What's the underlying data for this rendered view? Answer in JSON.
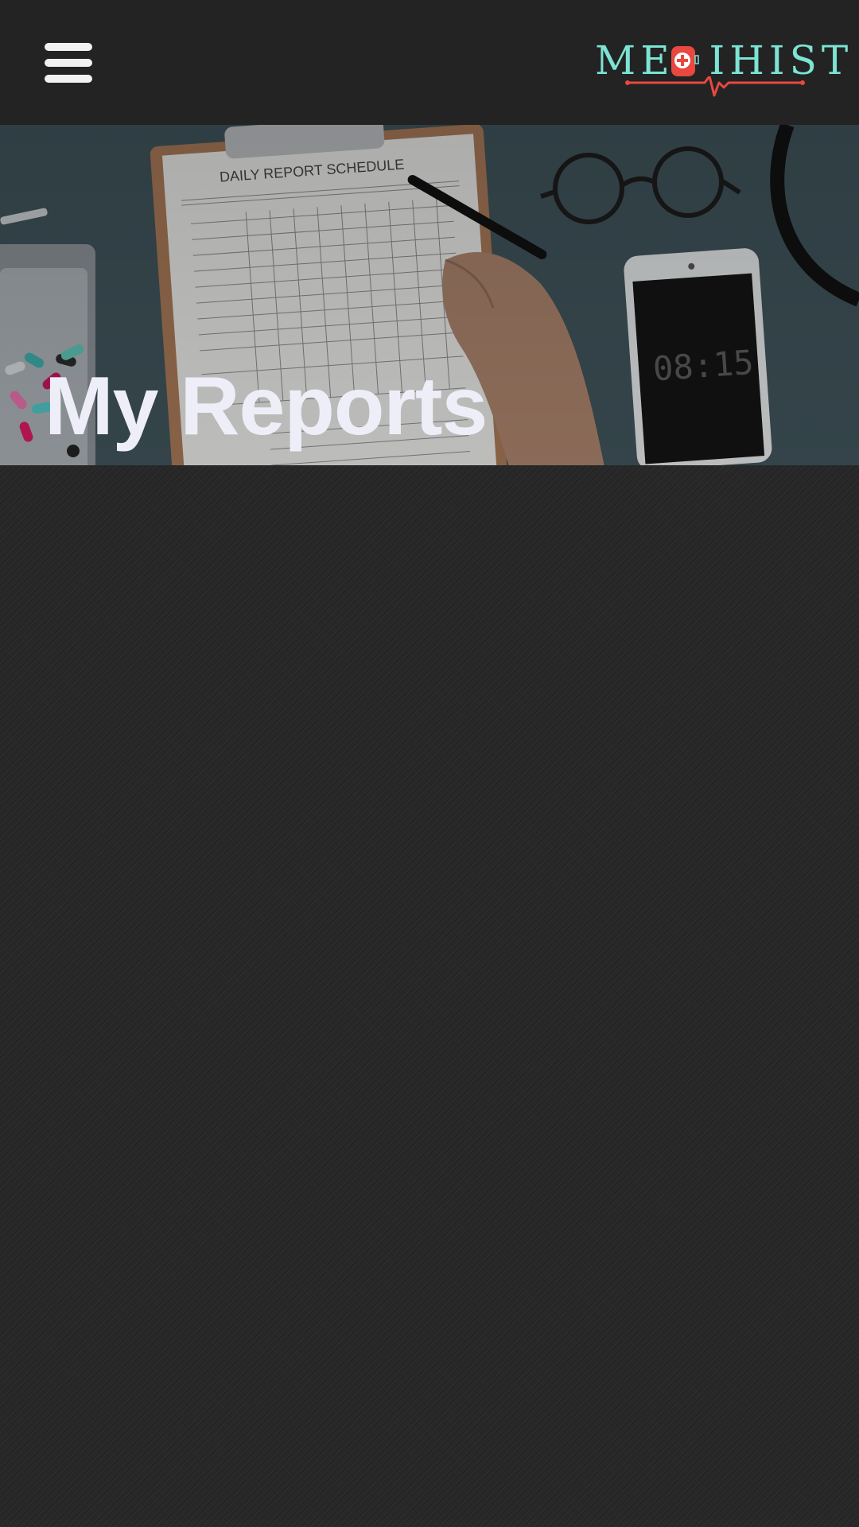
{
  "header": {
    "menu_icon": "hamburger-menu-icon",
    "logo_text": "ME  IHIST",
    "logo_alt": "MEDIHIST",
    "colors": {
      "logo_text": "#7de3d3",
      "logo_accent": "#e8483f",
      "header_bg": "#232323"
    }
  },
  "hero": {
    "title": "My Reports",
    "image_subject": "clipboard-with-report-photo",
    "clipboard_heading": "DAILY REPORT SCHEDULE",
    "phone_clock": "08:15"
  },
  "content": {
    "background": "#262626"
  }
}
